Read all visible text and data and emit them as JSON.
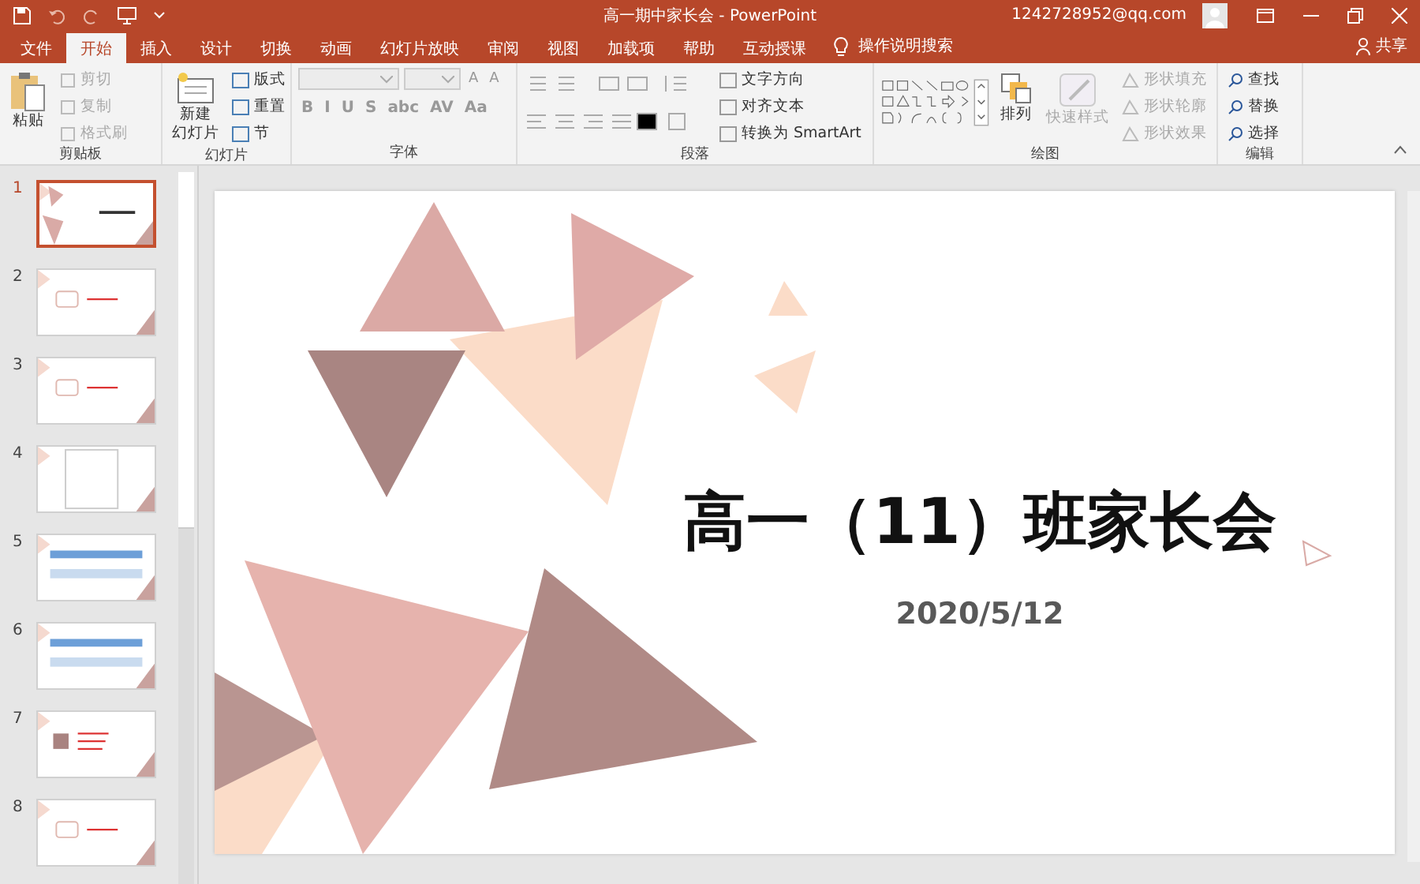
{
  "window": {
    "title": "高一期中家长会  -  PowerPoint",
    "account": "1242728952@qq.com"
  },
  "tabs": [
    {
      "label": "文件",
      "selected": false
    },
    {
      "label": "开始",
      "selected": true
    },
    {
      "label": "插入",
      "selected": false
    },
    {
      "label": "设计",
      "selected": false
    },
    {
      "label": "切换",
      "selected": false
    },
    {
      "label": "动画",
      "selected": false
    },
    {
      "label": "幻灯片放映",
      "selected": false
    },
    {
      "label": "审阅",
      "selected": false
    },
    {
      "label": "视图",
      "selected": false
    },
    {
      "label": "加载项",
      "selected": false
    },
    {
      "label": "帮助",
      "selected": false
    },
    {
      "label": "互动授课",
      "selected": false
    }
  ],
  "tell_me": {
    "placeholder": "操作说明搜索"
  },
  "share": "共享",
  "ribbon": {
    "clipboard": {
      "label": "剪贴板",
      "paste": "粘贴",
      "items": [
        {
          "label": "剪切",
          "disabled": true
        },
        {
          "label": "复制",
          "disabled": true
        },
        {
          "label": "格式刷",
          "disabled": true
        }
      ]
    },
    "slides": {
      "label": "幻灯片",
      "new_slide": [
        "新建",
        "幻灯片"
      ],
      "items": [
        {
          "label": "版式",
          "disabled": false
        },
        {
          "label": "重置",
          "disabled": false
        },
        {
          "label": "节",
          "disabled": false
        }
      ]
    },
    "font": {
      "label": "字体",
      "size_buttons": [
        "A",
        "A"
      ],
      "format_buttons": [
        "B",
        "I",
        "U",
        "S",
        "abc",
        "AV",
        "Aa"
      ]
    },
    "paragraph": {
      "label": "段落",
      "items": [
        {
          "label": "文字方向",
          "disabled": false
        },
        {
          "label": "对齐文本",
          "disabled": false
        },
        {
          "label": "转换为 SmartArt",
          "disabled": false
        }
      ]
    },
    "drawing": {
      "label": "绘图",
      "arrange": "排列",
      "quick_styles": {
        "label": "快速样式",
        "disabled": true
      },
      "items": [
        {
          "label": "形状填充",
          "disabled": true
        },
        {
          "label": "形状轮廓",
          "disabled": true
        },
        {
          "label": "形状效果",
          "disabled": true
        }
      ]
    },
    "editing": {
      "label": "编辑",
      "items": [
        {
          "label": "查找",
          "disabled": false
        },
        {
          "label": "替换",
          "disabled": false
        },
        {
          "label": "选择",
          "disabled": false
        }
      ]
    }
  },
  "thumbnails": [
    {
      "number": "1",
      "selected": true
    },
    {
      "number": "2",
      "selected": false
    },
    {
      "number": "3",
      "selected": false
    },
    {
      "number": "4",
      "selected": false
    },
    {
      "number": "5",
      "selected": false
    },
    {
      "number": "6",
      "selected": false
    },
    {
      "number": "7",
      "selected": false
    },
    {
      "number": "8",
      "selected": false
    }
  ],
  "slide": {
    "title": "高一（11）班家长会",
    "date": "2020/5/12"
  }
}
